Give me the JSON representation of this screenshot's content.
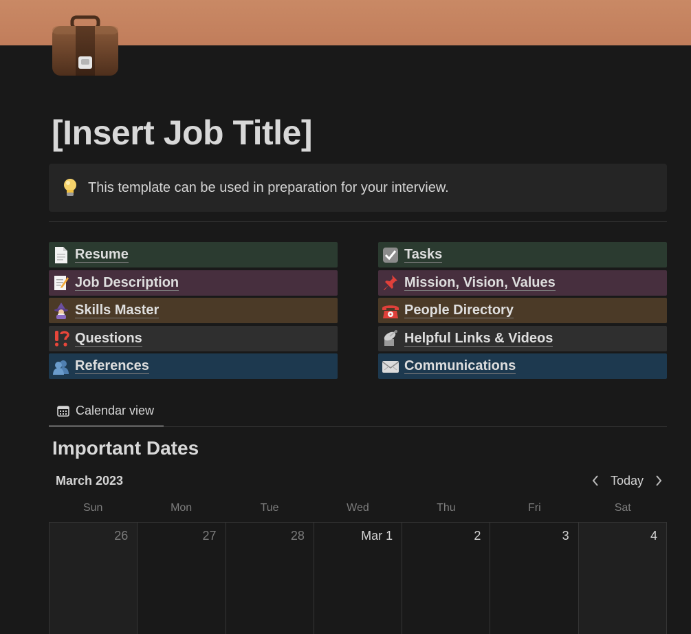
{
  "page": {
    "cover_color": "#c48160",
    "icon": "briefcase-icon",
    "title": "[Insert Job Title]"
  },
  "callout": {
    "icon": "lightbulb-icon",
    "text": "This template can be used in preparation for your interview."
  },
  "links_left": [
    {
      "label": "Resume",
      "icon": "page-icon",
      "color": "#2b3b30"
    },
    {
      "label": "Job Description",
      "icon": "memo-icon",
      "color": "#472f3e"
    },
    {
      "label": "Skills Master",
      "icon": "mage-icon",
      "color": "#4b3a27"
    },
    {
      "label": "Questions",
      "icon": "exclamation-question-icon",
      "color": "#2f2f2f"
    },
    {
      "label": "References",
      "icon": "people-icon",
      "color": "#1d394f"
    }
  ],
  "links_right": [
    {
      "label": "Tasks",
      "icon": "checkbox-icon",
      "color": "#2b3b30"
    },
    {
      "label": "Mission, Vision, Values",
      "icon": "pushpin-icon",
      "color": "#472f3e"
    },
    {
      "label": "People Directory",
      "icon": "telephone-icon",
      "color": "#4b3a27"
    },
    {
      "label": "Helpful Links & Videos",
      "icon": "satellite-icon",
      "color": "#2f2f2f"
    },
    {
      "label": "Communications",
      "icon": "envelope-icon",
      "color": "#1d394f"
    }
  ],
  "view": {
    "tab_label": "Calendar view",
    "tab_icon": "calendar-icon"
  },
  "database": {
    "title": "Important Dates",
    "month": "March 2023",
    "today_label": "Today",
    "weekdays": [
      "Sun",
      "Mon",
      "Tue",
      "Wed",
      "Thu",
      "Fri",
      "Sat"
    ],
    "days": [
      {
        "label": "26",
        "muted": true
      },
      {
        "label": "27",
        "muted": true
      },
      {
        "label": "28",
        "muted": true
      },
      {
        "label": "Mar 1",
        "muted": false
      },
      {
        "label": "2",
        "muted": false
      },
      {
        "label": "3",
        "muted": false
      },
      {
        "label": "4",
        "muted": false
      }
    ]
  }
}
